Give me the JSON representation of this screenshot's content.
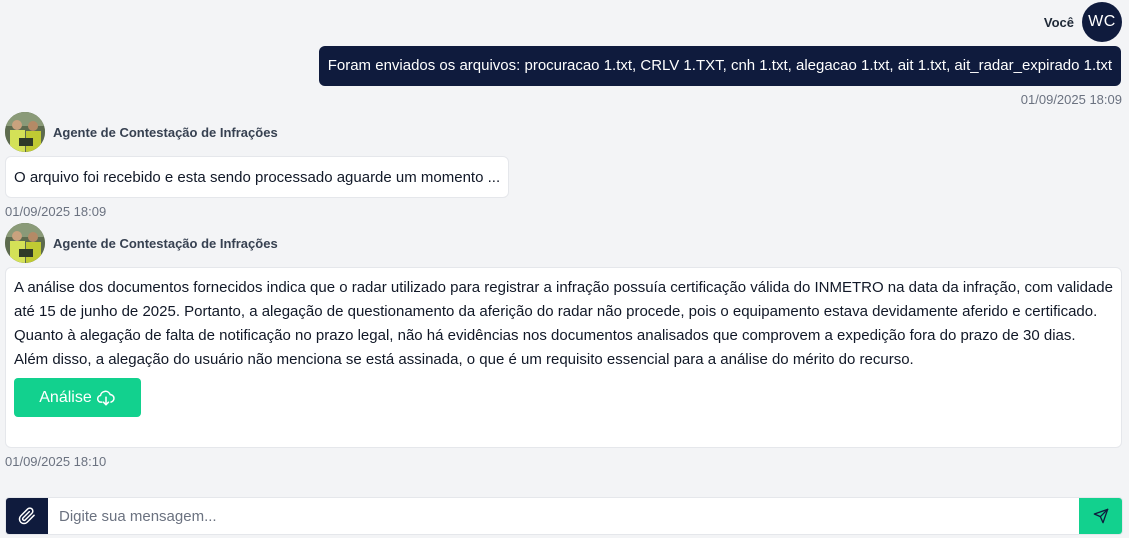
{
  "user": {
    "name": "Você",
    "initials": "WC",
    "message": "Foram enviados os arquivos: procuracao 1.txt, CRLV 1.TXT, cnh 1.txt, alegacao 1.txt, ait 1.txt, ait_radar_expirado 1.txt",
    "time": "01/09/2025 18:09"
  },
  "agent_messages": [
    {
      "name": "Agente de Contestação de Infrações",
      "text": "O arquivo foi recebido e esta sendo processado aguarde um momento ...",
      "time": "01/09/2025 18:09"
    },
    {
      "name": "Agente de Contestação de Infrações",
      "text": "A análise dos documentos fornecidos indica que o radar utilizado para registrar a infração possuía certificação válida do INMETRO na data da infração, com validade até 15 de junho de 2025. Portanto, a alegação de questionamento da aferição do radar não procede, pois o equipamento estava devidamente aferido e certificado. Quanto à alegação de falta de notificação no prazo legal, não há evidências nos documentos analisados que comprovem a expedição fora do prazo de 30 dias. Além disso, a alegação do usuário não menciona se está assinada, o que é um requisito essencial para a análise do mérito do recurso.",
      "button_label": "Análise",
      "button_icon": "cloud-download-icon",
      "time": "01/09/2025 18:10"
    }
  ],
  "input": {
    "placeholder": "Digite sua mensagem...",
    "value": "",
    "attach_icon": "paperclip-icon",
    "send_icon": "send-icon"
  },
  "colors": {
    "navy": "#0f1b3d",
    "accent_green": "#12d18e",
    "background": "#f3f4f6"
  }
}
